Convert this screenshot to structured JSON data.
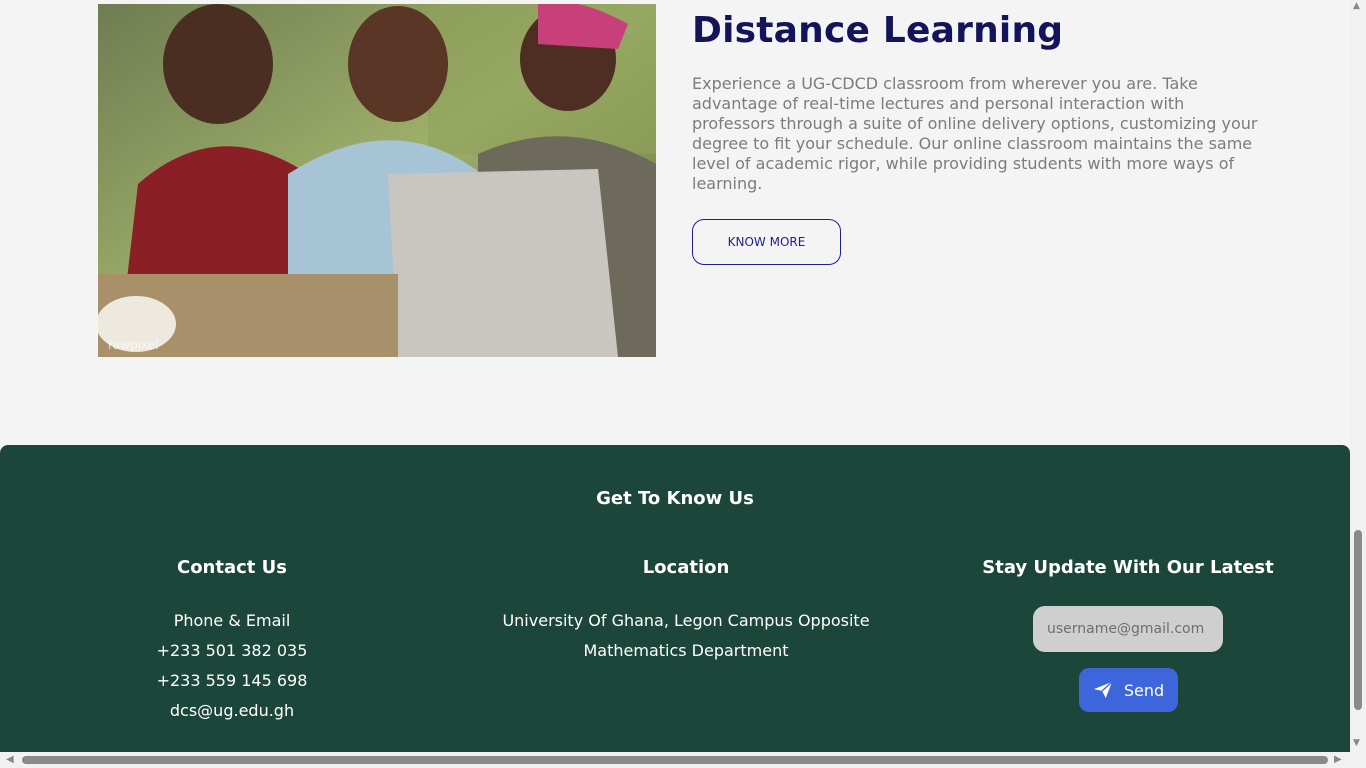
{
  "distance_learning": {
    "title": "Distance Learning",
    "description": "Experience a UG-CDCD classroom from wherever you are. Take advantage of real-time lectures and personal interaction with professors through a suite of online delivery options, customizing your degree to fit your schedule. Our online classroom maintains the same level of academic rigor, while providing students with more ways of learning.",
    "button_label": "KNOW MORE",
    "image_watermark": "rawpixel"
  },
  "footer": {
    "title": "Get To Know Us",
    "contact": {
      "heading": "Contact Us",
      "lines": [
        "Phone & Email",
        "+233 501 382 035",
        "+233 559 145 698",
        "dcs@ug.edu.gh"
      ]
    },
    "location": {
      "heading": "Location",
      "lines": [
        "University Of Ghana, Legon Campus Opposite",
        "Mathematics Department"
      ]
    },
    "newsletter": {
      "heading": "Stay Update With Our Latest",
      "email_placeholder": "username@gmail.com",
      "send_label": "Send"
    }
  },
  "colors": {
    "footer_bg": "#1c463a",
    "title": "#14145a",
    "send_button": "#3e66dc"
  }
}
